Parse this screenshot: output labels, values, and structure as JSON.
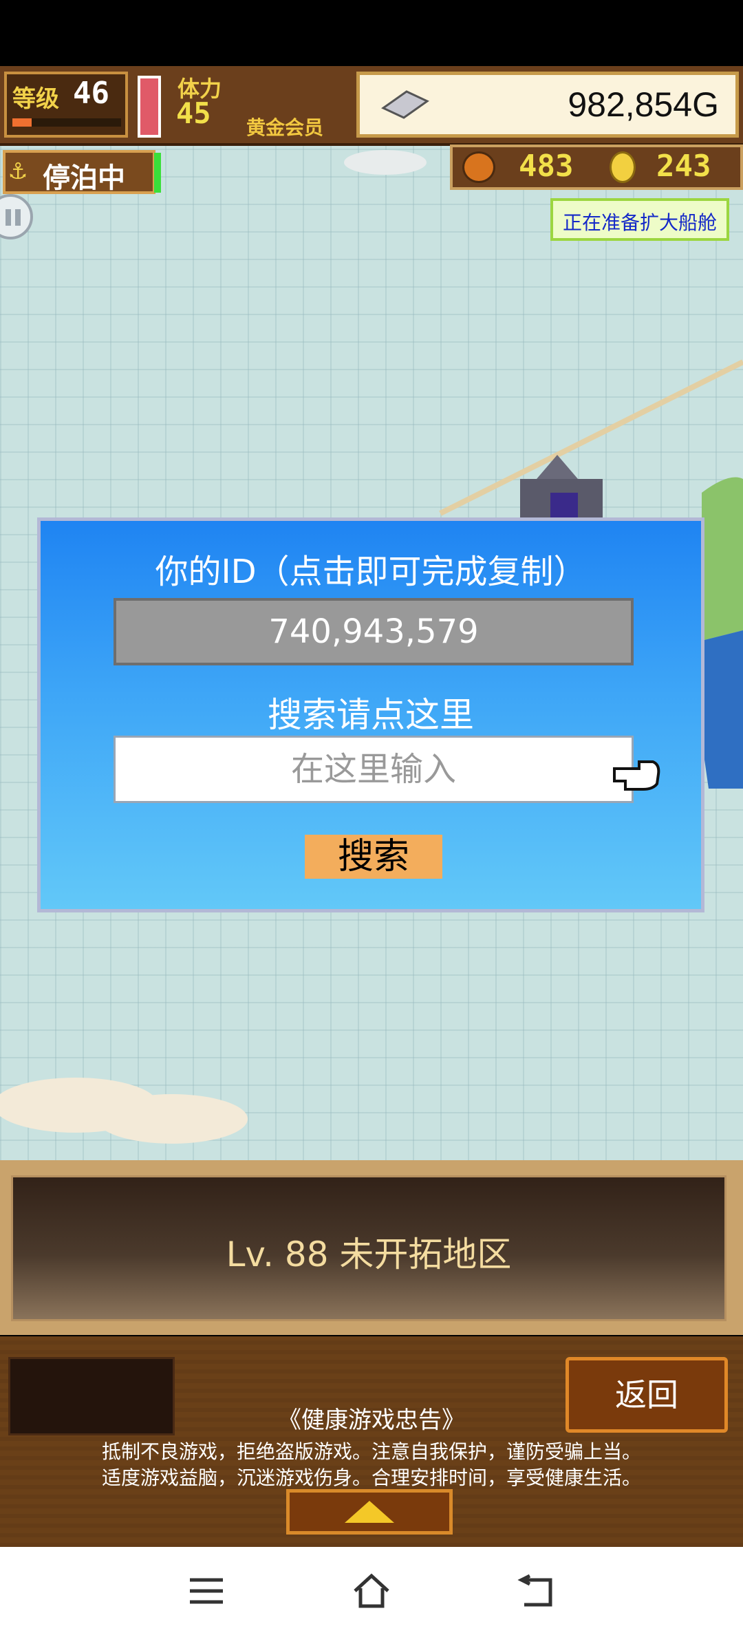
{
  "hud": {
    "level_label": "等级",
    "level_value": "46",
    "stamina_label": "体力",
    "stamina_value": "45",
    "member_label": "黄金会员",
    "money": "982,854G",
    "status": "停泊中",
    "resource_food": "483",
    "resource_coin": "243",
    "expand_text": "正在准备扩大船舱"
  },
  "dialog": {
    "id_title": "你的ID（点击即可完成复制）",
    "id_value": "740,943,579",
    "search_title": "搜索请点这里",
    "search_placeholder": "在这里输入",
    "search_button": "搜索"
  },
  "location": {
    "banner": "Lv. 88 未开拓地区"
  },
  "bottom": {
    "notice_title": "《健康游戏忠告》",
    "notice_line1": "抵制不良游戏，拒绝盗版游戏。注意自我保护，谨防受骗上当。",
    "notice_line2": "适度游戏益脑，沉迷游戏伤身。合理安排时间，享受健康生活。",
    "back_button": "返回"
  },
  "nav": {
    "icons": [
      "menu-icon",
      "home-icon",
      "back-icon"
    ]
  }
}
